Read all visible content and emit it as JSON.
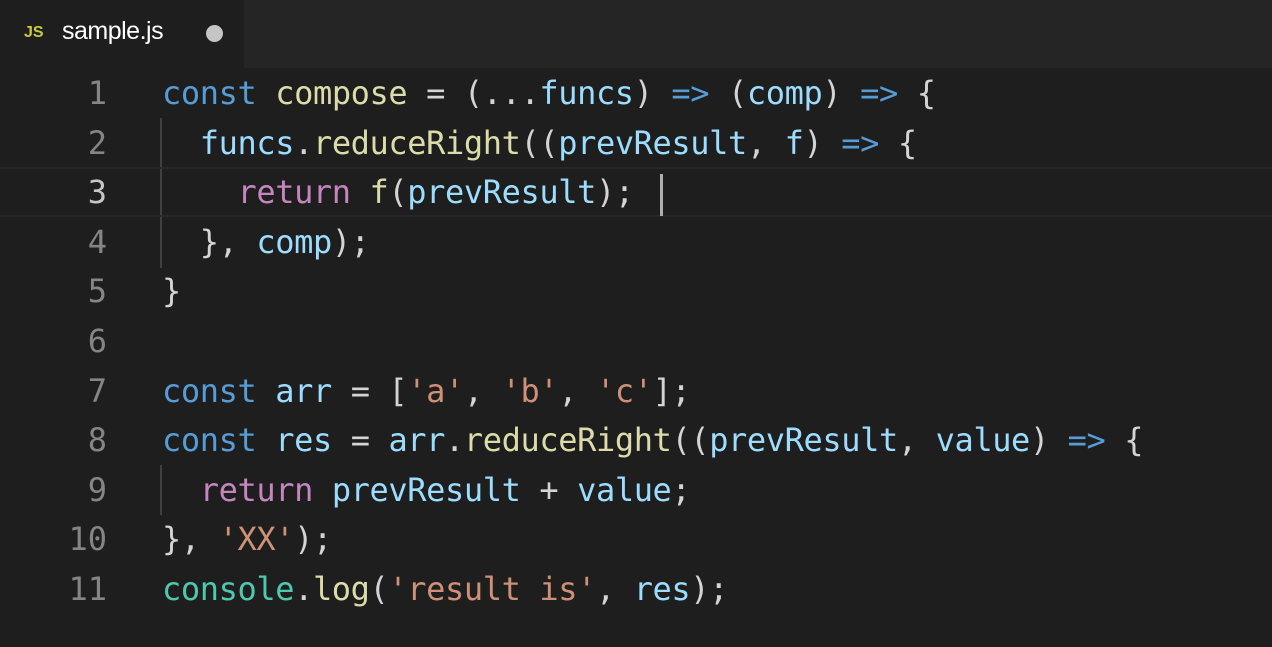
{
  "tab": {
    "icon_label": "JS",
    "filename": "sample.js"
  },
  "colors": {
    "background": "#1e1e1e",
    "keyword": "#569cd6",
    "control": "#c586c0",
    "function": "#dcdcaa",
    "variable": "#9cdcfe",
    "string": "#ce9178",
    "class": "#4ec9b0"
  },
  "editor": {
    "current_line": 3,
    "lines": [
      {
        "number": "1",
        "tokens": [
          [
            "kw",
            "const"
          ],
          [
            "punc",
            " "
          ],
          [
            "fn",
            "compose"
          ],
          [
            "punc",
            " = (..."
          ],
          [
            "var",
            "funcs"
          ],
          [
            "punc",
            ") "
          ],
          [
            "op",
            "=>"
          ],
          [
            "punc",
            " ("
          ],
          [
            "var",
            "comp"
          ],
          [
            "punc",
            ") "
          ],
          [
            "op",
            "=>"
          ],
          [
            "punc",
            " {"
          ]
        ]
      },
      {
        "number": "2",
        "tokens": [
          [
            "punc",
            "  "
          ],
          [
            "var",
            "funcs"
          ],
          [
            "punc",
            "."
          ],
          [
            "fn",
            "reduceRight"
          ],
          [
            "punc",
            "(("
          ],
          [
            "var",
            "prevResult"
          ],
          [
            "punc",
            ", "
          ],
          [
            "var",
            "f"
          ],
          [
            "punc",
            ") "
          ],
          [
            "op",
            "=>"
          ],
          [
            "punc",
            " {"
          ]
        ]
      },
      {
        "number": "3",
        "tokens": [
          [
            "punc",
            "    "
          ],
          [
            "ctrl",
            "return"
          ],
          [
            "punc",
            " "
          ],
          [
            "fn",
            "f"
          ],
          [
            "punc",
            "("
          ],
          [
            "var",
            "prevResult"
          ],
          [
            "punc",
            ");"
          ]
        ]
      },
      {
        "number": "4",
        "tokens": [
          [
            "punc",
            "  }, "
          ],
          [
            "var",
            "comp"
          ],
          [
            "punc",
            ");"
          ]
        ]
      },
      {
        "number": "5",
        "tokens": [
          [
            "punc",
            "}"
          ]
        ]
      },
      {
        "number": "6",
        "tokens": []
      },
      {
        "number": "7",
        "tokens": [
          [
            "kw",
            "const"
          ],
          [
            "punc",
            " "
          ],
          [
            "var",
            "arr"
          ],
          [
            "punc",
            " = ["
          ],
          [
            "str",
            "'a'"
          ],
          [
            "punc",
            ", "
          ],
          [
            "str",
            "'b'"
          ],
          [
            "punc",
            ", "
          ],
          [
            "str",
            "'c'"
          ],
          [
            "punc",
            "];"
          ]
        ]
      },
      {
        "number": "8",
        "tokens": [
          [
            "kw",
            "const"
          ],
          [
            "punc",
            " "
          ],
          [
            "var",
            "res"
          ],
          [
            "punc",
            " = "
          ],
          [
            "var",
            "arr"
          ],
          [
            "punc",
            "."
          ],
          [
            "fn",
            "reduceRight"
          ],
          [
            "punc",
            "(("
          ],
          [
            "var",
            "prevResult"
          ],
          [
            "punc",
            ", "
          ],
          [
            "var",
            "value"
          ],
          [
            "punc",
            ") "
          ],
          [
            "op",
            "=>"
          ],
          [
            "punc",
            " {"
          ]
        ]
      },
      {
        "number": "9",
        "tokens": [
          [
            "punc",
            "  "
          ],
          [
            "ctrl",
            "return"
          ],
          [
            "punc",
            " "
          ],
          [
            "var",
            "prevResult"
          ],
          [
            "punc",
            " + "
          ],
          [
            "var",
            "value"
          ],
          [
            "punc",
            ";"
          ]
        ]
      },
      {
        "number": "10",
        "tokens": [
          [
            "punc",
            "}, "
          ],
          [
            "str",
            "'XX'"
          ],
          [
            "punc",
            ");"
          ]
        ]
      },
      {
        "number": "11",
        "tokens": [
          [
            "cls",
            "console"
          ],
          [
            "punc",
            "."
          ],
          [
            "fn",
            "log"
          ],
          [
            "punc",
            "("
          ],
          [
            "str",
            "'result is'"
          ],
          [
            "punc",
            ", "
          ],
          [
            "var",
            "res"
          ],
          [
            "punc",
            ");"
          ]
        ]
      }
    ]
  }
}
